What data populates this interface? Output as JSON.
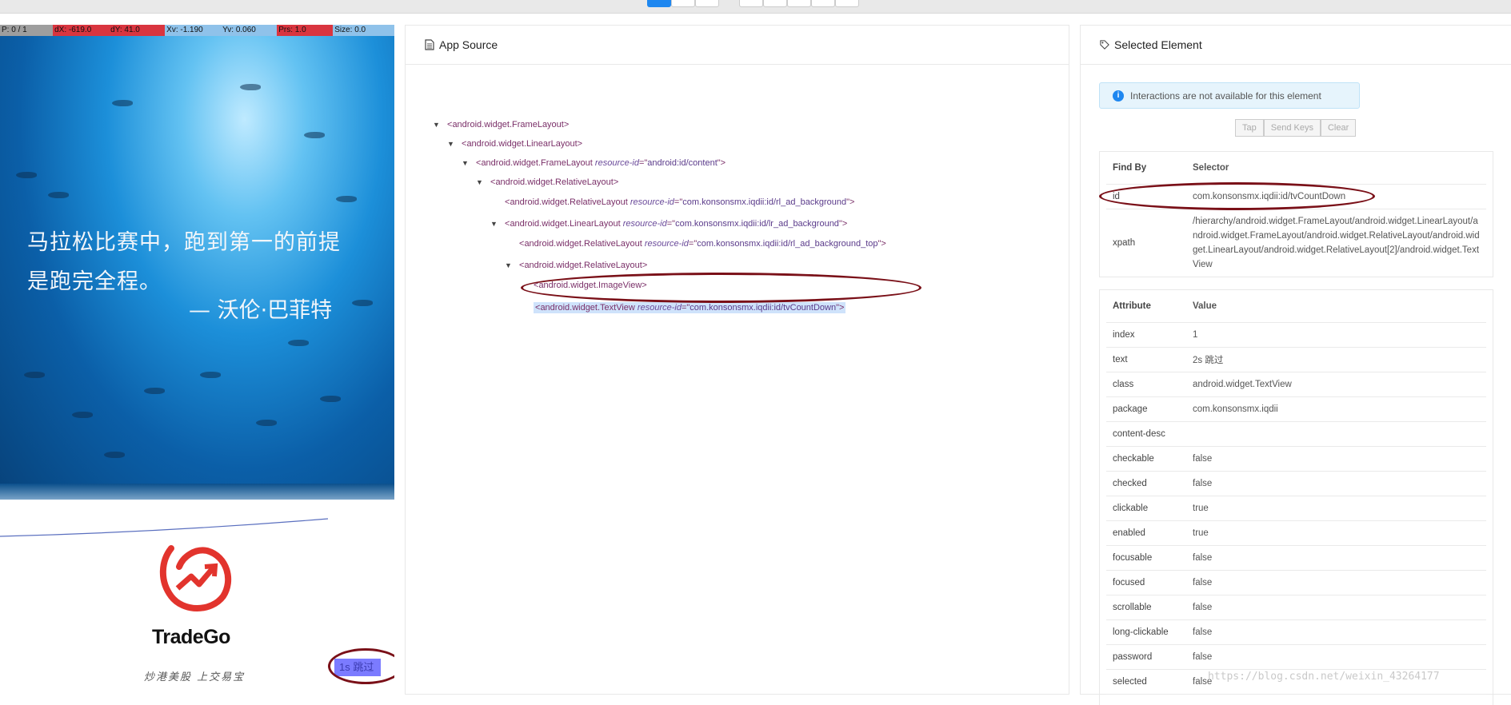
{
  "pointer_bar": [
    {
      "text": "P: 0 / 1",
      "color": "#9e9e9e"
    },
    {
      "text": "dX: -619.0",
      "color": "#d9353f"
    },
    {
      "text": "dY: 41.0",
      "color": "#d9353f"
    },
    {
      "text": "Xv: -1.190",
      "color": "#8fc2ea"
    },
    {
      "text": "Yv: 0.060",
      "color": "#8fc2ea"
    },
    {
      "text": "Prs: 1.0",
      "color": "#d9353f"
    },
    {
      "text": "Size: 0.0",
      "color": "#8fc2ea"
    }
  ],
  "device": {
    "quote_line1": "马拉松比赛中，跑到第一的前提",
    "quote_line2": "是跑完全程。",
    "quote_author": "— 沃伦·巴菲特",
    "logo_text": "TradeGo",
    "slogan": "炒港美股 上交易宝",
    "skip_button": "1s 跳过"
  },
  "app_source": {
    "title": "App Source",
    "nodes": [
      {
        "tag": "android.widget.FrameLayout",
        "attr": "",
        "value": "",
        "caret": "▼"
      },
      {
        "tag": "android.widget.LinearLayout",
        "attr": "",
        "value": "",
        "caret": "▼"
      },
      {
        "tag": "android.widget.FrameLayout",
        "attr": "resource-id",
        "value": "android:id/content",
        "caret": "▼"
      },
      {
        "tag": "android.widget.RelativeLayout",
        "attr": "",
        "value": "",
        "caret": "▼"
      },
      {
        "tag": "android.widget.RelativeLayout",
        "attr": "resource-id",
        "value": "com.konsonsmx.iqdii:id/rl_ad_background",
        "caret": ""
      },
      {
        "tag": "android.widget.LinearLayout",
        "attr": "resource-id",
        "value": "com.konsonsmx.iqdii:id/lr_ad_background",
        "caret": "▼"
      },
      {
        "tag": "android.widget.RelativeLayout",
        "attr": "resource-id",
        "value": "com.konsonsmx.iqdii:id/rl_ad_background_top",
        "caret": ""
      },
      {
        "tag": "android.widget.RelativeLayout",
        "attr": "",
        "value": "",
        "caret": "▼"
      },
      {
        "tag": "android.widget.ImageView",
        "attr": "",
        "value": "",
        "caret": ""
      },
      {
        "tag": "android.widget.TextView",
        "attr": "resource-id",
        "value": "com.konsonsmx.iqdii:id/tvCountDown",
        "caret": "",
        "selected": true
      }
    ]
  },
  "selected_element": {
    "title": "Selected Element",
    "notice": "Interactions are not available for this element",
    "buttons": [
      "Tap",
      "Send Keys",
      "Clear"
    ],
    "find_by_header": [
      "Find By",
      "Selector"
    ],
    "find_by": [
      {
        "key": "id",
        "value": "com.konsonsmx.iqdii:id/tvCountDown"
      },
      {
        "key": "xpath",
        "value": "/hierarchy/android.widget.FrameLayout/android.widget.LinearLayout/android.widget.FrameLayout/android.widget.RelativeLayout/android.widget.LinearLayout/android.widget.RelativeLayout[2]/android.widget.TextView"
      }
    ],
    "attr_header": [
      "Attribute",
      "Value"
    ],
    "attributes": [
      {
        "key": "index",
        "value": "1"
      },
      {
        "key": "text",
        "value": "2s 跳过"
      },
      {
        "key": "class",
        "value": "android.widget.TextView"
      },
      {
        "key": "package",
        "value": "com.konsonsmx.iqdii"
      },
      {
        "key": "content-desc",
        "value": ""
      },
      {
        "key": "checkable",
        "value": "false"
      },
      {
        "key": "checked",
        "value": "false"
      },
      {
        "key": "clickable",
        "value": "true"
      },
      {
        "key": "enabled",
        "value": "true"
      },
      {
        "key": "focusable",
        "value": "false"
      },
      {
        "key": "focused",
        "value": "false"
      },
      {
        "key": "scrollable",
        "value": "false"
      },
      {
        "key": "long-clickable",
        "value": "false"
      },
      {
        "key": "password",
        "value": "false"
      },
      {
        "key": "selected",
        "value": "false"
      }
    ]
  },
  "watermark": "https://blog.csdn.net/weixin_43264177"
}
